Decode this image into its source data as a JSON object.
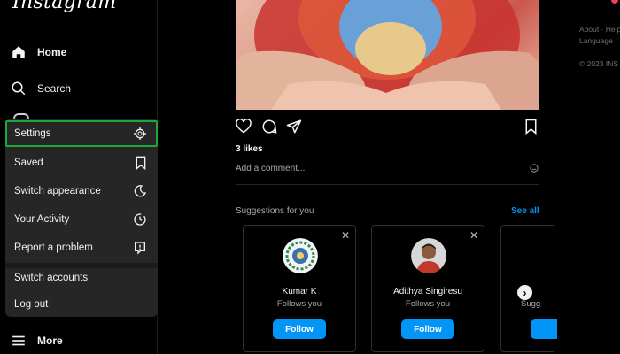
{
  "app": {
    "logo": "Instagram"
  },
  "nav": {
    "home": "Home",
    "search": "Search",
    "more": "More"
  },
  "menu": {
    "items": [
      {
        "label": "Settings",
        "icon": "settings-icon",
        "selected": true
      },
      {
        "label": "Saved",
        "icon": "bookmark-icon"
      },
      {
        "label": "Switch appearance",
        "icon": "moon-icon"
      },
      {
        "label": "Your Activity",
        "icon": "activity-icon"
      },
      {
        "label": "Report a problem",
        "icon": "report-icon"
      },
      {
        "label": "Switch accounts",
        "icon": ""
      },
      {
        "label": "Log out",
        "icon": ""
      }
    ]
  },
  "post": {
    "likes": "3 likes",
    "comment_placeholder": "Add a comment..."
  },
  "suggestions": {
    "title": "Suggestions for you",
    "see_all": "See all",
    "cards": [
      {
        "name": "Kumar K",
        "subtitle": "Follows you",
        "button": "Follow"
      },
      {
        "name": "Adithya Singiresu",
        "subtitle": "Follows you",
        "button": "Follow"
      },
      {
        "name": "",
        "subtitle": "Sugg",
        "button": ""
      }
    ]
  },
  "footer": {
    "links_line1": "About · Help",
    "links_line2": "Language",
    "copyright": "© 2023 INS"
  },
  "colors": {
    "accent": "#0095f6",
    "selection_outline": "#1ea83a",
    "menu_bg": "#262626"
  }
}
